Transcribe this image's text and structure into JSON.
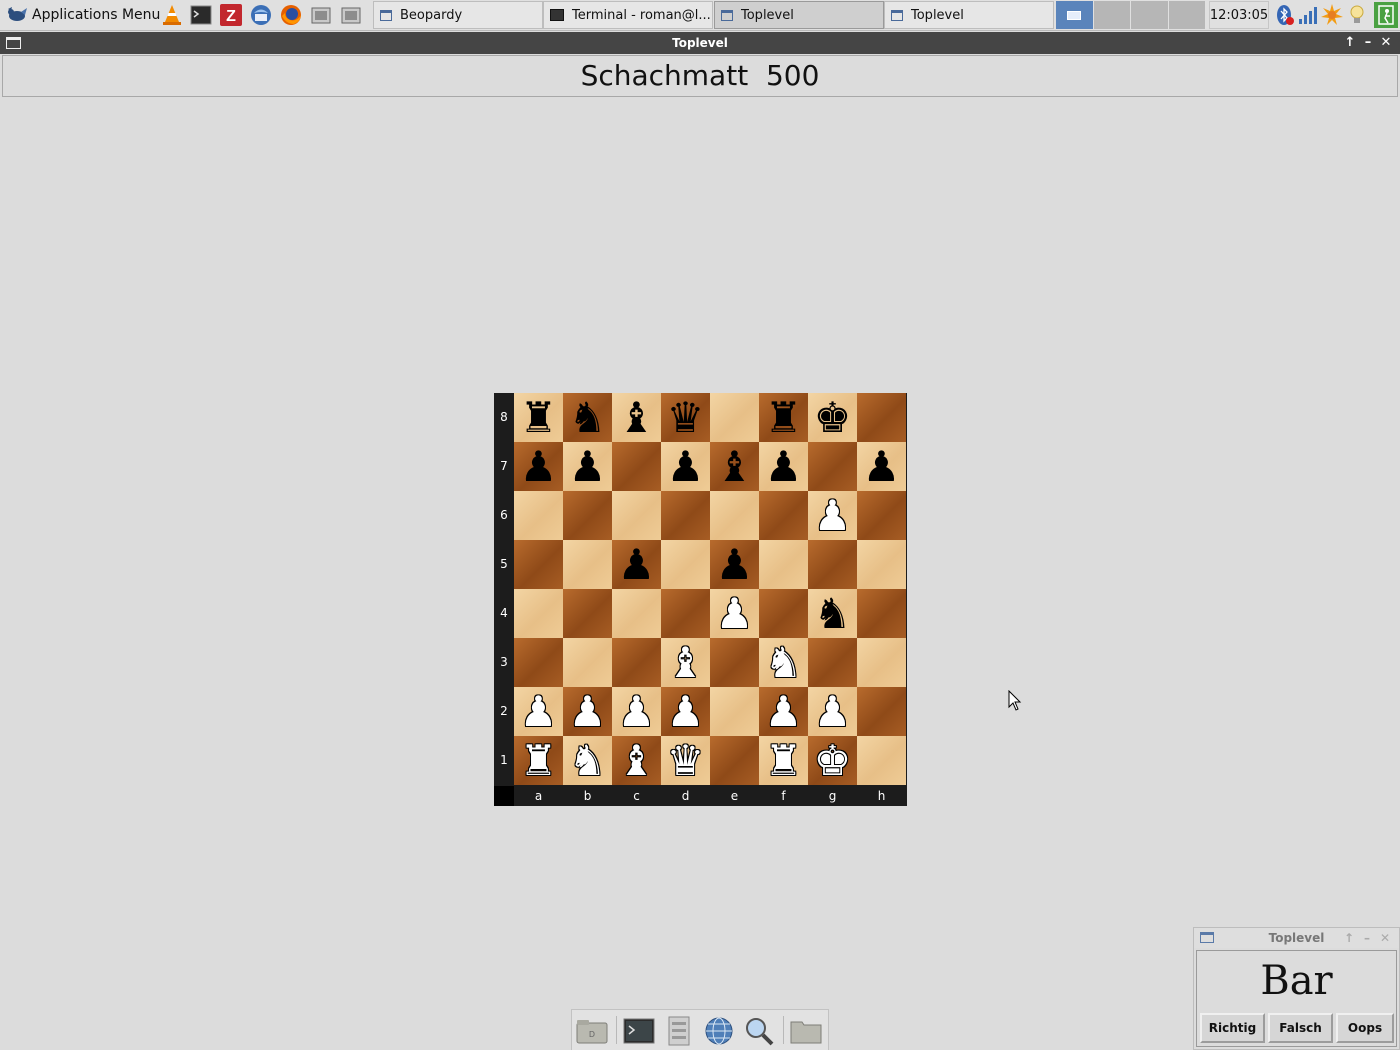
{
  "taskbar": {
    "app_menu_label": "Applications Menu",
    "launchers": [
      {
        "name": "vlc-icon"
      },
      {
        "name": "terminal-icon"
      },
      {
        "name": "filezilla-icon"
      },
      {
        "name": "thunderbird-icon"
      },
      {
        "name": "firefox-icon"
      },
      {
        "name": "screenshot-icon"
      },
      {
        "name": "screenshot-icon"
      }
    ],
    "tasks": [
      {
        "label": "Beopardy",
        "type": "window",
        "active": false
      },
      {
        "label": "Terminal - roman@l...",
        "type": "terminal",
        "active": false
      },
      {
        "label": "Toplevel",
        "type": "window",
        "active": true
      },
      {
        "label": "Toplevel",
        "type": "window",
        "active": false
      }
    ],
    "workspaces": 4,
    "current_workspace": 1,
    "clock": "12:03:05",
    "tray_icons": [
      "bluetooth-icon",
      "network-icon",
      "weather-icon",
      "lightbulb-icon",
      "exit-icon"
    ]
  },
  "main_window": {
    "title": "Toplevel",
    "header": "Schachmatt  500"
  },
  "chess_board": {
    "files": [
      "a",
      "b",
      "c",
      "d",
      "e",
      "f",
      "g",
      "h"
    ],
    "ranks": [
      "8",
      "7",
      "6",
      "5",
      "4",
      "3",
      "2",
      "1"
    ],
    "rows": [
      [
        "r",
        "n",
        "b",
        "q",
        "",
        "r",
        "k",
        ""
      ],
      [
        "p",
        "p",
        "",
        "p",
        "b",
        "p",
        "",
        "p"
      ],
      [
        "",
        "",
        "",
        "",
        "",
        "",
        "P",
        ""
      ],
      [
        "",
        "",
        "p",
        "",
        "p",
        "",
        "",
        ""
      ],
      [
        "",
        "",
        "",
        "",
        "P",
        "",
        "n",
        ""
      ],
      [
        "",
        "",
        "",
        "B",
        "",
        "N",
        "",
        ""
      ],
      [
        "P",
        "P",
        "P",
        "P",
        "",
        "P",
        "P",
        ""
      ],
      [
        "R",
        "N",
        "B",
        "Q",
        "",
        "R",
        "K",
        ""
      ]
    ]
  },
  "dock": {
    "items": [
      "show-desktop-icon",
      "terminal-icon",
      "file-manager-icon",
      "web-browser-icon",
      "search-icon",
      "folder-icon"
    ]
  },
  "small_window": {
    "title": "Toplevel",
    "word": "Bar",
    "buttons": {
      "correct": "Richtig",
      "wrong": "Falsch",
      "oops": "Oops"
    }
  }
}
